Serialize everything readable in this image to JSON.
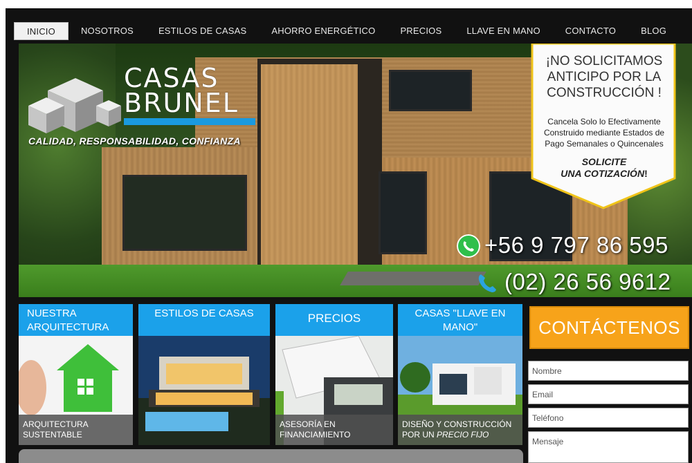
{
  "nav": {
    "items": [
      "INICIO",
      "NOSOTROS",
      "ESTILOS DE CASAS",
      "AHORRO ENERGÉTICO",
      "PRECIOS",
      "LLAVE EN MANO",
      "CONTACTO",
      "BLOG"
    ],
    "active": "INICIO"
  },
  "hero": {
    "logo_line1": "CASAS",
    "logo_line2": "BRUNEL",
    "tagline": "CALIDAD, RESPONSABILIDAD, CONFIANZA",
    "badge_title": "¡NO SOLICITAMOS ANTICIPO POR LA CONSTRUCCIÓN !",
    "badge_body": "Cancela Solo lo Efectivamente Construido mediante Estados de Pago Semanales o Quincenales",
    "badge_cta_line1": "SOLICITE",
    "badge_cta_line2": "UNA COTIZACIÓN",
    "badge_cta_excl": "!",
    "phone_mobile": "+56 9 797 86 595",
    "phone_landline": "(02) 26 56 9612",
    "whatsapp_icon": "whatsapp-icon",
    "phone_icon": "phone-icon"
  },
  "tiles": [
    {
      "title": "NUESTRA ARQUITECTURA",
      "caption": "ARQUITECTURA SUSTENTABLE"
    },
    {
      "title": "ESTILOS DE CASAS",
      "caption": ""
    },
    {
      "title": "PRECIOS",
      "caption": "ASESORÍA EN FINANCIAMIENTO"
    },
    {
      "title": "CASAS \"LLAVE EN MANO\"",
      "caption_main": "DISEÑO Y CONSTRUCCIÓN POR UN ",
      "caption_em": "PRECIO FIJO"
    }
  ],
  "contact": {
    "button": "CONTÁCTENOS",
    "fields": [
      "Nombre",
      "Email",
      "Teléfono",
      "Mensaje"
    ]
  },
  "colors": {
    "accent_blue": "#1ba1ea",
    "accent_orange": "#f7a31a",
    "badge_yellow": "#f6d23a"
  }
}
